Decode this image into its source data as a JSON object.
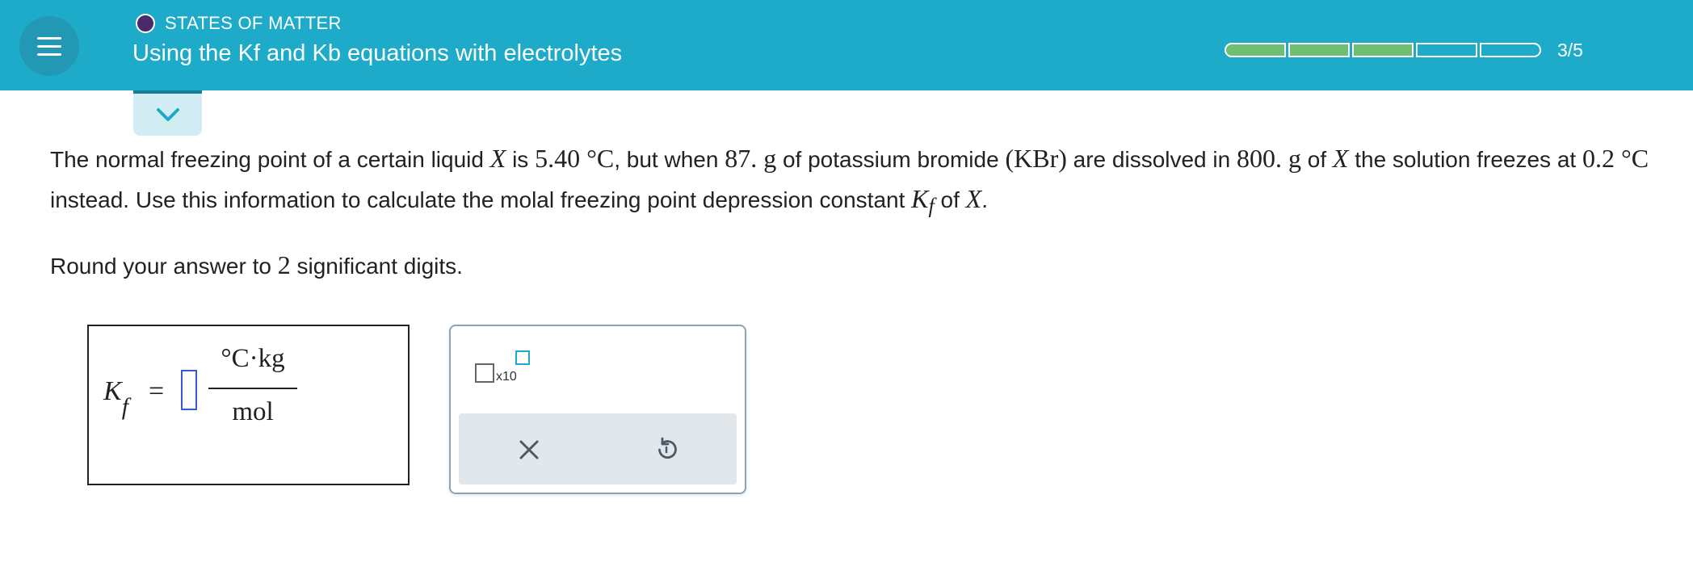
{
  "header": {
    "topic": "STATES OF MATTER",
    "title": "Using the Kf and Kb equations with electrolytes",
    "progress_text": "3/5",
    "progress_done": 3,
    "progress_total": 5,
    "colors": {
      "bar": "#1eabc9",
      "done": "#6fbf73",
      "topic_dot": "#4b2a6b"
    }
  },
  "icons": {
    "menu": "hamburger-icon",
    "collapse": "chevron-down-icon",
    "clear": "x-icon",
    "undo": "undo-icon"
  },
  "problem": {
    "t1": "The normal freezing point of a certain liquid ",
    "x1": "X",
    "t2": " is ",
    "m1": "5.40 °C",
    "t3": ", but when ",
    "m2": "87. g",
    "t4": " of potassium bromide ",
    "m3": "(KBr)",
    "t5": " are dissolved in ",
    "m4": "800. g",
    "t6": " of ",
    "x2": "X",
    "t7": " the solution freezes at ",
    "m5": "0.2 °C",
    "t8": " instead. Use this information to calculate the molal freezing point depression constant ",
    "k": "K",
    "ksub": "f",
    "t9": " of ",
    "x3": "X",
    "t10": "."
  },
  "round": {
    "pre": "Round your answer to ",
    "num": "2",
    "post": " significant digits."
  },
  "answer": {
    "k": "K",
    "sub": "f",
    "equals": "=",
    "value": "",
    "unit_num": "°C·kg",
    "unit_den": "mol"
  },
  "tools": {
    "sci_label": "x10"
  }
}
